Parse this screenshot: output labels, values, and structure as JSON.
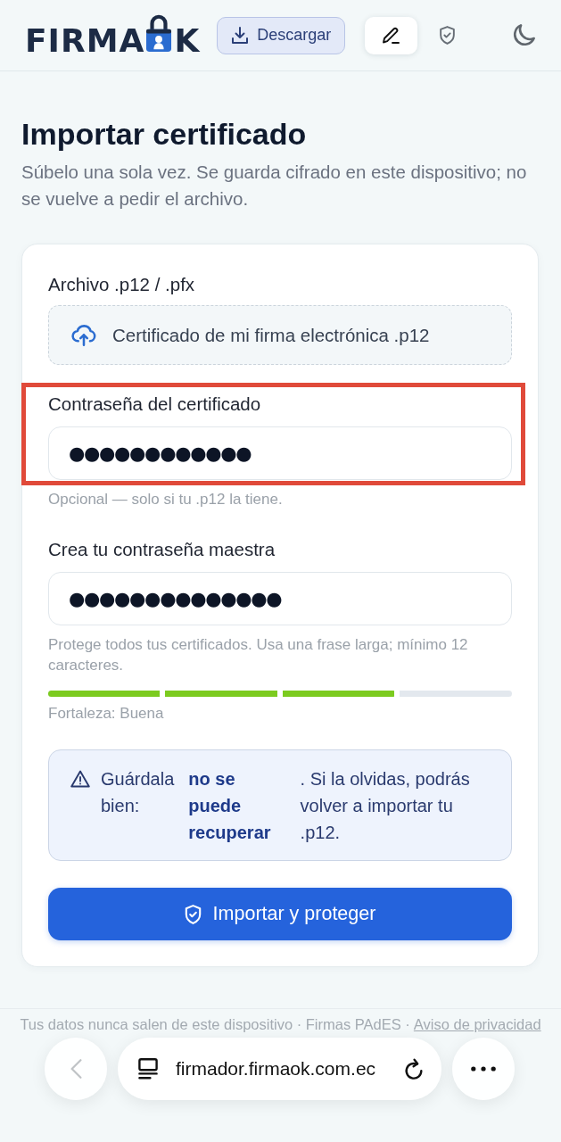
{
  "header": {
    "logo": {
      "prefix": "FIRMA",
      "suffix": "K"
    },
    "download_button": "Descargar",
    "mode_tabs": [
      {
        "selected": true
      },
      {
        "selected": false
      }
    ]
  },
  "page": {
    "title": "Importar certificado",
    "subtitle": "Súbelo una sola vez. Se guarda cifrado en este dispositivo; no se vuelve a pedir el archivo."
  },
  "form": {
    "file": {
      "label": "Archivo .p12 / .pfx",
      "value": "Certificado de mi firma electrónica .p12"
    },
    "fields": [
      {
        "label": "Contraseña del certificado",
        "value": "●●●●●●●●●●●●",
        "hint": "Opcional — solo si tu .p12 la tiene.",
        "highlighted": true
      },
      {
        "label": "Crea tu contraseña maestra",
        "value": "●●●●●●●●●●●●●●",
        "hint": "Protege todos tus certificados. Usa una frase larga; mínimo 12 caracteres.",
        "highlighted": false
      }
    ],
    "strength": {
      "level": 0.75,
      "label": "Fortaleza: Buena"
    },
    "warning": "Guárdala bien: **no se puede recuperar**. Si la olvidas, podrás volver a importar tu .p12.",
    "submit_button": "Importar y proteger"
  },
  "footer": {
    "text": "Tus datos nunca salen de este dispositivo · Firmas PAdES ·",
    "link": "Aviso de privacidad"
  },
  "browser_bar": {
    "back_disabled": true,
    "url": "firmador.firmaok.com.ec"
  }
}
